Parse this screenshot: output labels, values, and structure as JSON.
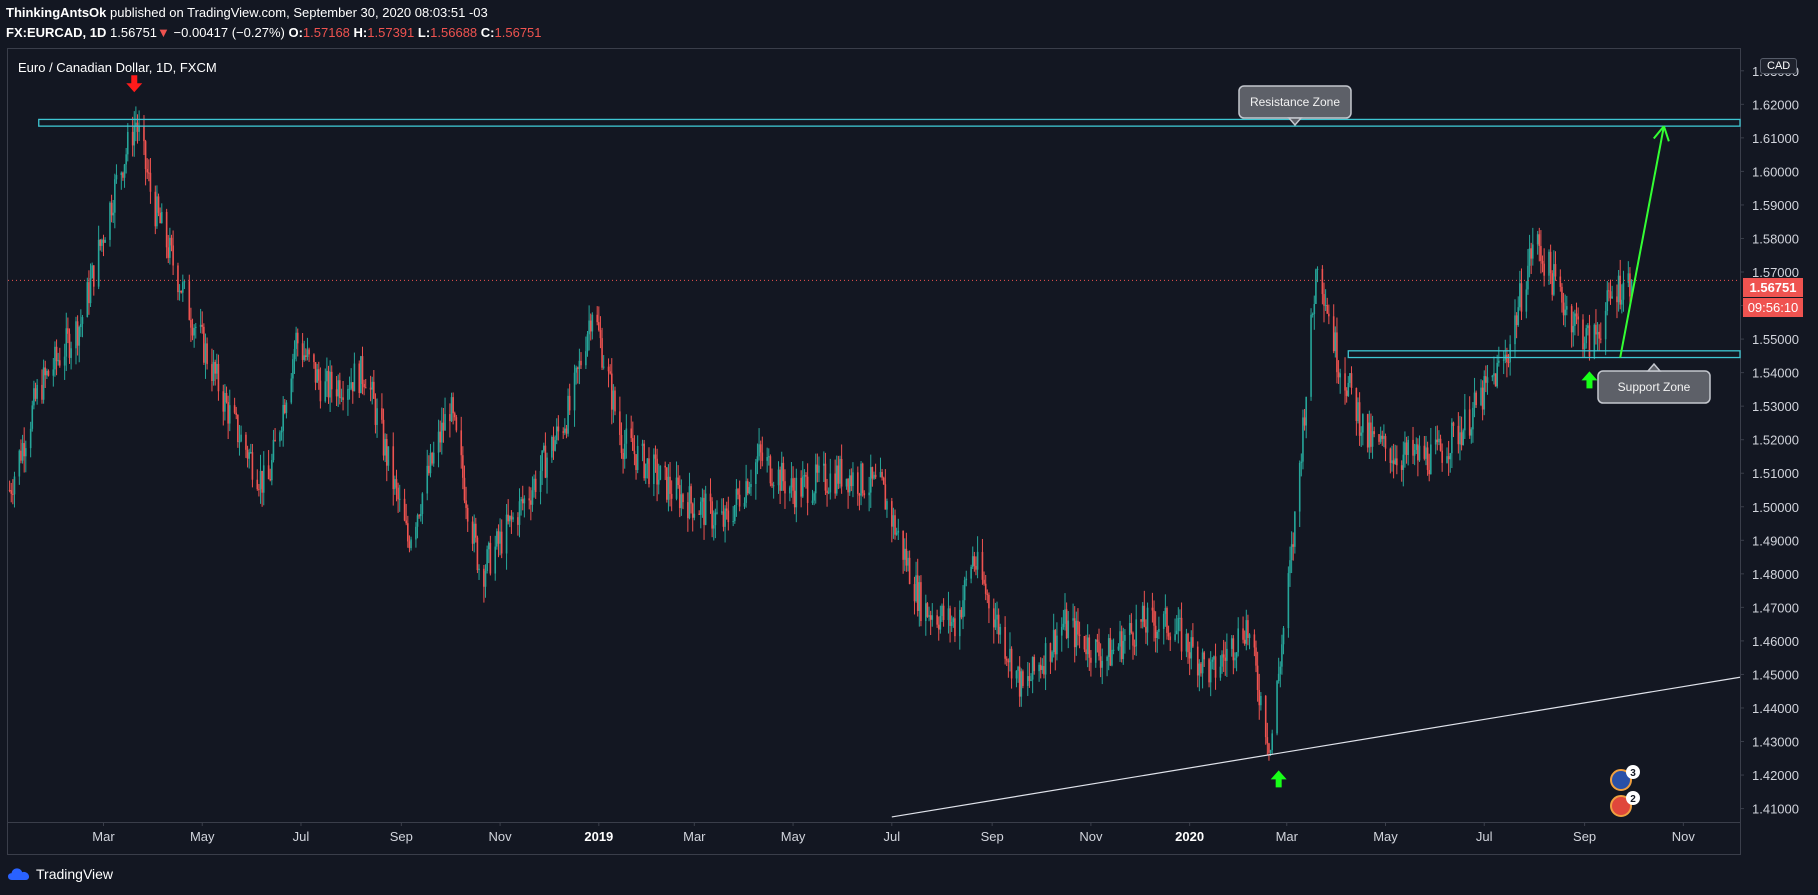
{
  "header": {
    "author": "ThinkingAntsOk",
    "published_text": "published on TradingView.com, September 30, 2020 08:03:51 -03",
    "symbol": "FX:EURCAD, 1D",
    "last": "1.56751",
    "change_arrow": "▼",
    "change": "−0.00417 (−0.27%)",
    "o_label": "O:",
    "o_value": "1.57168",
    "h_label": "H:",
    "h_value": "1.57391",
    "l_label": "L:",
    "l_value": "1.56688",
    "c_label": "C:",
    "c_value": "1.56751"
  },
  "chart_title": "Euro / Canadian Dollar, 1D, FXCM",
  "currency_badge": "CAD",
  "price_label": "1.56751",
  "countdown_label": "09:56:10",
  "logo_text": "TradingView",
  "chart_data": {
    "type": "candlestick",
    "title": "Euro / Canadian Dollar, 1D, FXCM",
    "ylim": [
      1.406,
      1.6365
    ],
    "y_ticks": [
      "1.63000",
      "1.62000",
      "1.61000",
      "1.60000",
      "1.59000",
      "1.58000",
      "1.57000",
      "1.56000",
      "1.55000",
      "1.54000",
      "1.53000",
      "1.52000",
      "1.51000",
      "1.50000",
      "1.49000",
      "1.48000",
      "1.47000",
      "1.46000",
      "1.45000",
      "1.44000",
      "1.43000",
      "1.42000",
      "1.41000"
    ],
    "x_ticks": [
      {
        "label": "Mar",
        "date": "2018-03-01"
      },
      {
        "label": "May",
        "date": "2018-05-01"
      },
      {
        "label": "Jul",
        "date": "2018-07-01"
      },
      {
        "label": "Sep",
        "date": "2018-09-01"
      },
      {
        "label": "Nov",
        "date": "2018-11-01"
      },
      {
        "label": "2019",
        "date": "2019-01-01",
        "bold": true
      },
      {
        "label": "Mar",
        "date": "2019-03-01"
      },
      {
        "label": "May",
        "date": "2019-05-01"
      },
      {
        "label": "Jul",
        "date": "2019-07-01"
      },
      {
        "label": "Sep",
        "date": "2019-09-01"
      },
      {
        "label": "Nov",
        "date": "2019-11-01"
      },
      {
        "label": "2020",
        "date": "2020-01-01",
        "bold": true
      },
      {
        "label": "Mar",
        "date": "2020-03-01"
      },
      {
        "label": "May",
        "date": "2020-05-01"
      },
      {
        "label": "Jul",
        "date": "2020-07-01"
      },
      {
        "label": "Sep",
        "date": "2020-09-01"
      },
      {
        "label": "Nov",
        "date": "2020-11-01"
      }
    ],
    "close_path": [
      {
        "date": "2018-01-02",
        "value": 1.505
      },
      {
        "date": "2018-01-20",
        "value": 1.535
      },
      {
        "date": "2018-02-15",
        "value": 1.555
      },
      {
        "date": "2018-03-08",
        "value": 1.595
      },
      {
        "date": "2018-03-21",
        "value": 1.615
      },
      {
        "date": "2018-04-01",
        "value": 1.59
      },
      {
        "date": "2018-04-22",
        "value": 1.56
      },
      {
        "date": "2018-05-20",
        "value": 1.525
      },
      {
        "date": "2018-06-10",
        "value": 1.505
      },
      {
        "date": "2018-06-28",
        "value": 1.55
      },
      {
        "date": "2018-07-15",
        "value": 1.535
      },
      {
        "date": "2018-08-10",
        "value": 1.54
      },
      {
        "date": "2018-09-05",
        "value": 1.49
      },
      {
        "date": "2018-10-01",
        "value": 1.53
      },
      {
        "date": "2018-10-20",
        "value": 1.48
      },
      {
        "date": "2018-11-20",
        "value": 1.505
      },
      {
        "date": "2018-12-15",
        "value": 1.53
      },
      {
        "date": "2018-12-28",
        "value": 1.56
      },
      {
        "date": "2019-01-15",
        "value": 1.52
      },
      {
        "date": "2019-02-15",
        "value": 1.505
      },
      {
        "date": "2019-03-20",
        "value": 1.495
      },
      {
        "date": "2019-04-10",
        "value": 1.515
      },
      {
        "date": "2019-05-01",
        "value": 1.505
      },
      {
        "date": "2019-06-01",
        "value": 1.51
      },
      {
        "date": "2019-06-25",
        "value": 1.505
      },
      {
        "date": "2019-07-20",
        "value": 1.47
      },
      {
        "date": "2019-08-10",
        "value": 1.465
      },
      {
        "date": "2019-08-20",
        "value": 1.485
      },
      {
        "date": "2019-09-20",
        "value": 1.445
      },
      {
        "date": "2019-10-15",
        "value": 1.465
      },
      {
        "date": "2019-11-10",
        "value": 1.455
      },
      {
        "date": "2019-12-01",
        "value": 1.465
      },
      {
        "date": "2019-12-20",
        "value": 1.465
      },
      {
        "date": "2020-01-15",
        "value": 1.45
      },
      {
        "date": "2020-02-05",
        "value": 1.465
      },
      {
        "date": "2020-02-20",
        "value": 1.428
      },
      {
        "date": "2020-03-05",
        "value": 1.49
      },
      {
        "date": "2020-03-20",
        "value": 1.575
      },
      {
        "date": "2020-04-01",
        "value": 1.545
      },
      {
        "date": "2020-04-20",
        "value": 1.52
      },
      {
        "date": "2020-05-10",
        "value": 1.515
      },
      {
        "date": "2020-06-01",
        "value": 1.515
      },
      {
        "date": "2020-06-20",
        "value": 1.525
      },
      {
        "date": "2020-07-15",
        "value": 1.545
      },
      {
        "date": "2020-08-01",
        "value": 1.58
      },
      {
        "date": "2020-08-20",
        "value": 1.56
      },
      {
        "date": "2020-09-05",
        "value": 1.548
      },
      {
        "date": "2020-09-20",
        "value": 1.565
      },
      {
        "date": "2020-09-30",
        "value": 1.56751
      }
    ],
    "last_price": 1.56751,
    "drawings": {
      "resistance_zone": {
        "label": "Resistance Zone",
        "y_low": 1.6135,
        "y_high": 1.6155,
        "start": "2018-01-20"
      },
      "support_zone": {
        "label": "Support Zone",
        "y_low": 1.5445,
        "y_high": 1.5465,
        "start": "2020-04-08"
      },
      "trendline": {
        "from": {
          "date": "2019-07-01",
          "value": 1.4075
        },
        "to": {
          "date": "2020-02-25",
          "value": 1.4265
        },
        "extends_right": true
      },
      "projection_arrow": {
        "from": {
          "date": "2020-09-23",
          "value": 1.5445
        },
        "to": {
          "date": "2020-10-20",
          "value": 1.6135
        }
      },
      "markers": [
        {
          "type": "down-arrow",
          "date": "2018-03-20",
          "value": 1.626,
          "color": "#ff1b1b"
        },
        {
          "type": "up-arrow",
          "date": "2020-02-25",
          "value": 1.419,
          "color": "#18ff18"
        },
        {
          "type": "up-arrow",
          "date": "2020-09-04",
          "value": 1.538,
          "color": "#18ff18"
        }
      ]
    },
    "colors": {
      "up": "#26a69a",
      "down": "#ef5350",
      "zone": "#3ec6d2",
      "arrow": "#33ff33",
      "background": "#131722"
    }
  },
  "events": [
    {
      "count": "3"
    },
    {
      "count": "2"
    }
  ]
}
